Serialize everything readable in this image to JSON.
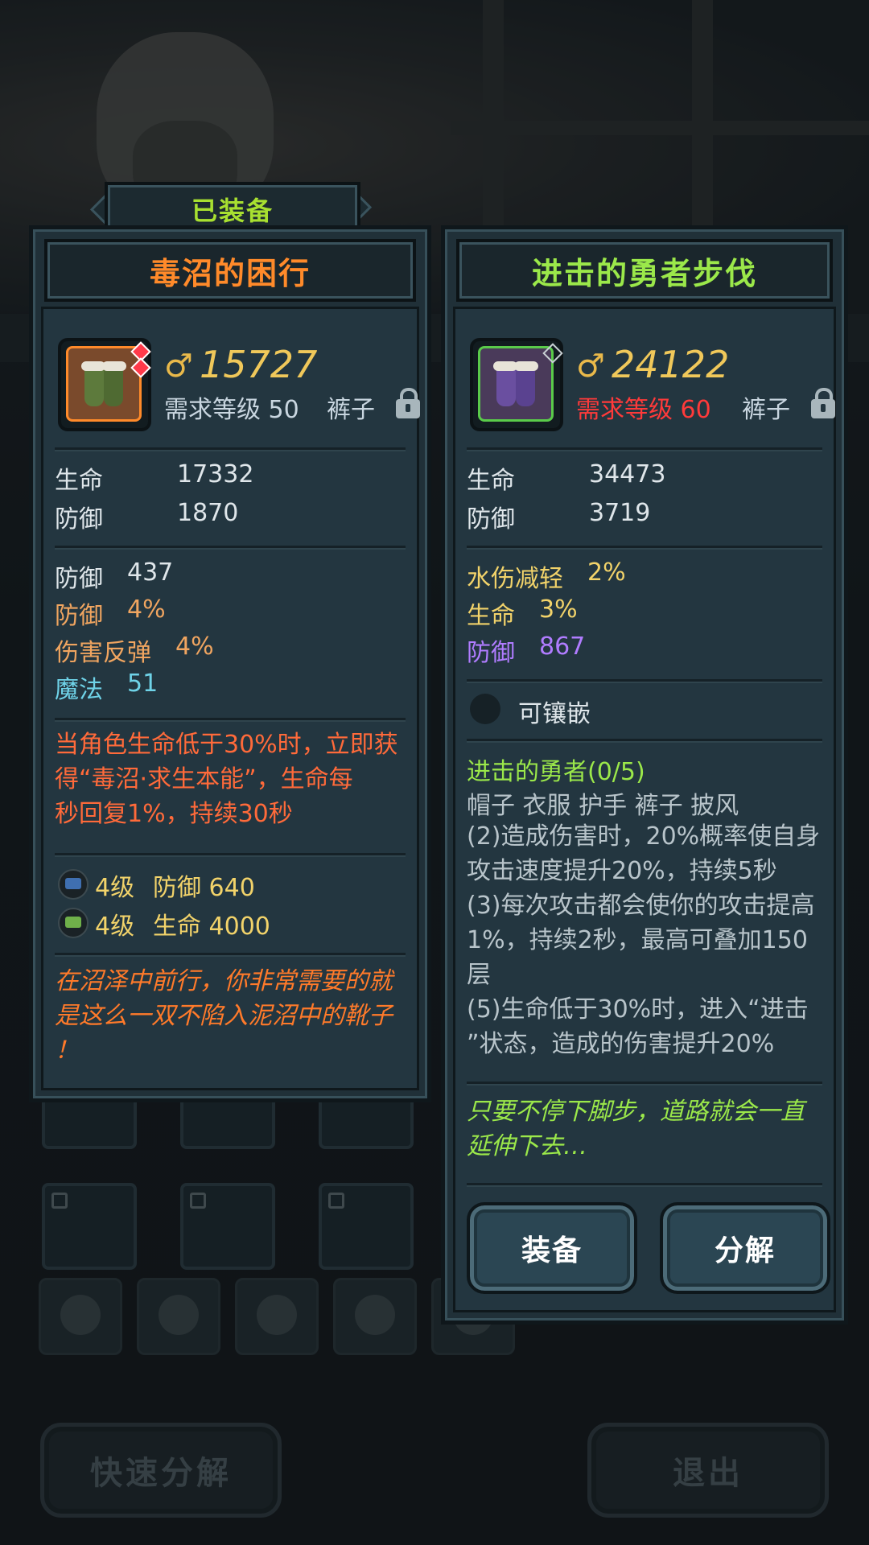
{
  "background": {
    "quick_decompose_label": "快速分解",
    "exit_label": "退出"
  },
  "equipped_tab": "已装备",
  "left": {
    "name": "毒沼的困行",
    "name_color": "#ff8a2a",
    "power": "15727",
    "required_level": "需求等级 50",
    "required_level_color": "#c9d6e0",
    "slot_type": "裤子",
    "base_stats": [
      {
        "label": "生命",
        "value": "17332"
      },
      {
        "label": "防御",
        "value": "1870"
      }
    ],
    "extra_stats": [
      {
        "label": "防御",
        "value": "437",
        "color": "#dfe6ea"
      },
      {
        "label": "防御",
        "value": "4%",
        "color": "#f0a560"
      },
      {
        "label": "伤害反弹",
        "value": "4%",
        "color": "#f0a560"
      },
      {
        "label": "魔法",
        "value": "51",
        "color": "#6fd3e8"
      }
    ],
    "special_lines": [
      "当角色生命低于30%时，立即获",
      "得“毒沼·求生本能”，生命每",
      "秒回复1%，持续30秒"
    ],
    "gems": [
      {
        "level": "4级",
        "stat": "防御 640",
        "icon": "blue-gem-icon"
      },
      {
        "level": "4级",
        "stat": "生命 4000",
        "icon": "green-gem-icon"
      }
    ],
    "flavor_lines": [
      "在沼泽中前行，你非常需要的就",
      "是这么一双不陷入泥沼中的靴子",
      "！"
    ]
  },
  "right": {
    "name": "进击的勇者步伐",
    "name_color": "#9be84a",
    "power": "24122",
    "required_level": "需求等级 60",
    "required_level_color": "#ff3a3a",
    "slot_type": "裤子",
    "base_stats": [
      {
        "label": "生命",
        "value": "34473"
      },
      {
        "label": "防御",
        "value": "3719"
      }
    ],
    "extra_stats": [
      {
        "label": "水伤减轻",
        "value": "2%",
        "color": "#f2d36a"
      },
      {
        "label": "生命",
        "value": "3%",
        "color": "#f2d36a"
      },
      {
        "label": "防御",
        "value": "867",
        "color": "#b07cff"
      }
    ],
    "socket_label": "可镶嵌",
    "set_name": "进击的勇者(0/5)",
    "set_pieces": "帽子 衣服 护手 裤子 披风",
    "set_lines": [
      "(2)造成伤害时，20%概率使自身",
      "攻击速度提升20%，持续5秒",
      "(3)每次攻击都会使你的攻击提高",
      "1%，持续2秒，最高可叠加150",
      "层",
      "(5)生命低于30%时，进入“进击",
      "”状态，造成的伤害提升20%"
    ],
    "flavor_lines": [
      "只要不停下脚步，道路就会一直",
      "延伸下去…"
    ],
    "equip_label": "装备",
    "decompose_label": "分解"
  }
}
